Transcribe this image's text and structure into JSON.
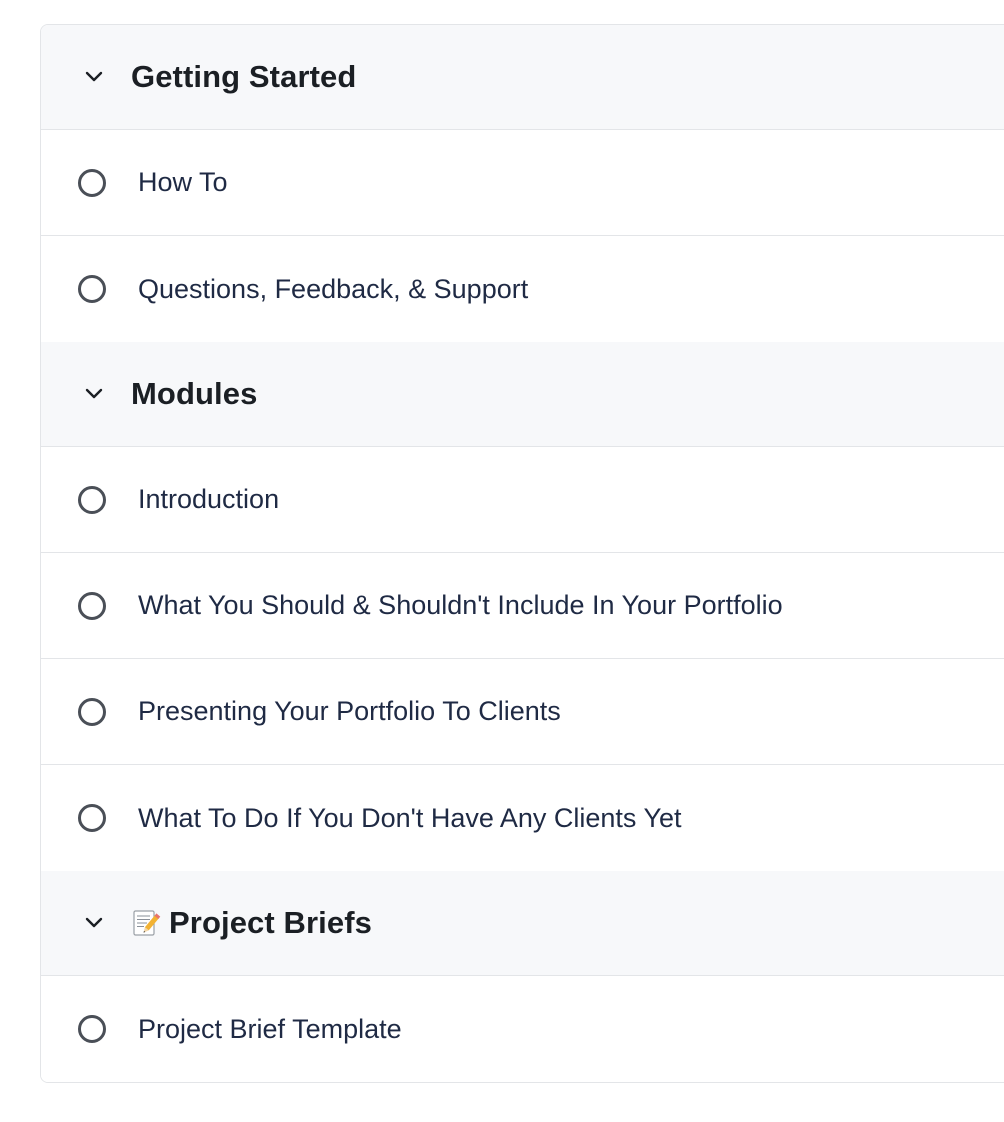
{
  "sections": [
    {
      "title": "Getting Started",
      "emoji": "",
      "lessons": [
        "How To",
        "Questions, Feedback, & Support"
      ]
    },
    {
      "title": "Modules",
      "emoji": "",
      "lessons": [
        "Introduction",
        "What You Should & Shouldn't Include In Your Portfolio",
        "Presenting Your Portfolio To Clients",
        "What To Do If You Don't Have Any Clients Yet"
      ]
    },
    {
      "title": "Project Briefs",
      "emoji": "memo-icon",
      "lessons": [
        "Project Brief Template"
      ]
    }
  ],
  "icons": {
    "section_toggle": "chevron-down-icon",
    "lesson_status": "empty-circle-icon"
  },
  "colors": {
    "header_bg": "#f7f8fa",
    "border": "#e3e5e8",
    "text": "#1f2a44"
  }
}
